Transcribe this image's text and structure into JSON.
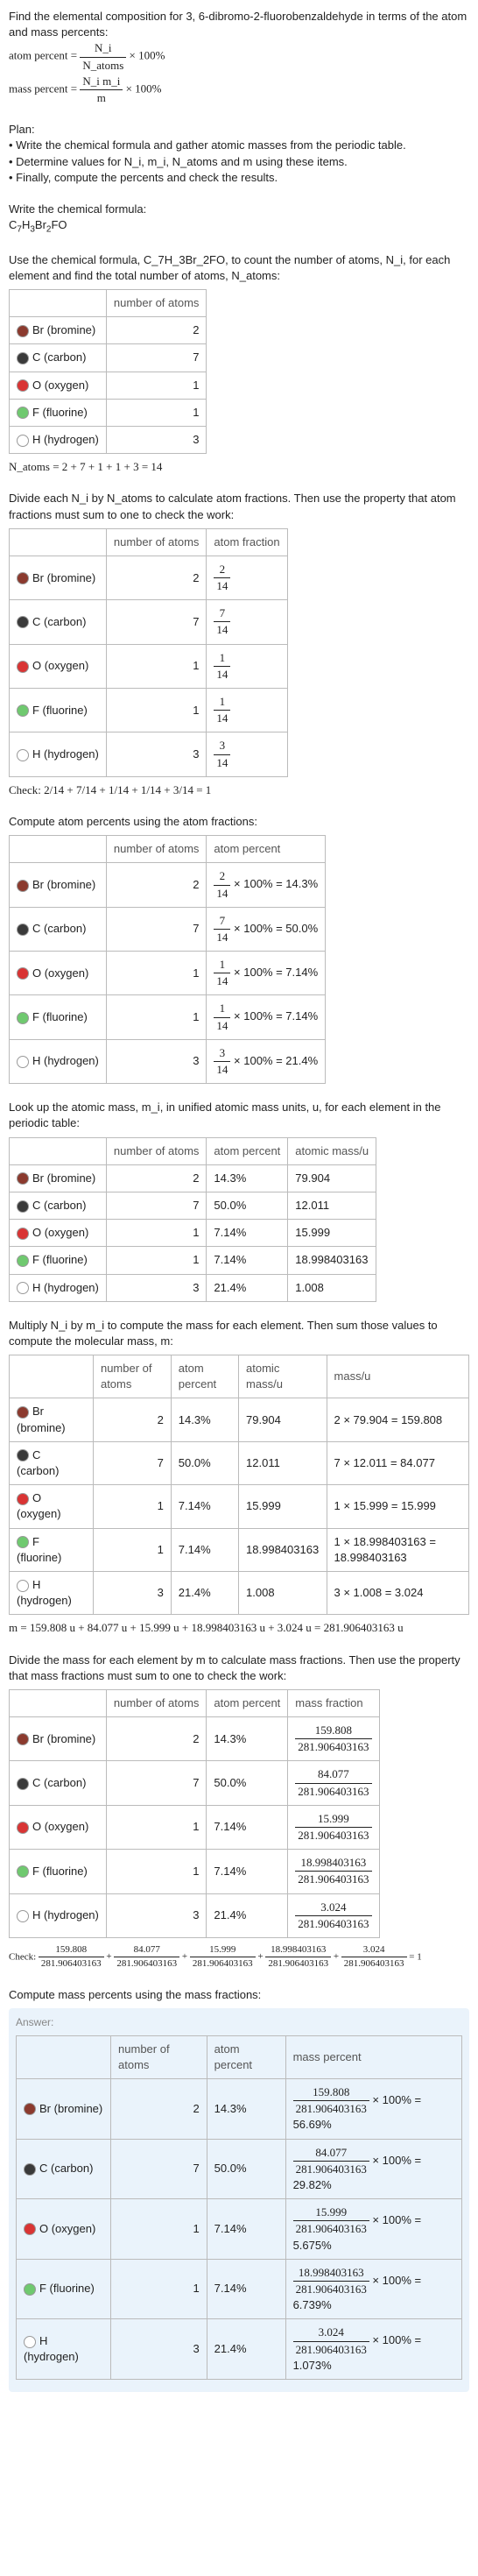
{
  "intro": {
    "line1": "Find the elemental composition for 3, 6-dibromo-2-fluorobenzaldehyde in terms of the atom and mass percents:",
    "atom_label": "atom percent =",
    "atom_num": "N_i",
    "atom_den": "N_atoms",
    "times100": "× 100%",
    "mass_label": "mass percent =",
    "mass_num": "N_i m_i",
    "mass_den": "m"
  },
  "plan": {
    "h": "Plan:",
    "b1": "• Write the chemical formula and gather atomic masses from the periodic table.",
    "b2": "• Determine values for N_i, m_i, N_atoms and m using these items.",
    "b3": "• Finally, compute the percents and check the results."
  },
  "step1": {
    "t": "Write the chemical formula:",
    "f": "C_7H_3Br_2FO"
  },
  "step2": {
    "t": "Use the chemical formula, C_7H_3Br_2FO, to count the number of atoms, N_i, for each element and find the total number of atoms, N_atoms:",
    "h1": "number of atoms",
    "r": [
      [
        "Br (bromine)",
        "2"
      ],
      [
        "C (carbon)",
        "7"
      ],
      [
        "O (oxygen)",
        "1"
      ],
      [
        "F (fluorine)",
        "1"
      ],
      [
        "H (hydrogen)",
        "3"
      ]
    ],
    "sum": "N_atoms = 2 + 7 + 1 + 1 + 3 = 14"
  },
  "step3": {
    "t": "Divide each N_i by N_atoms to calculate atom fractions. Then use the property that atom fractions must sum to one to check the work:",
    "h1": "number of atoms",
    "h2": "atom fraction",
    "r": [
      [
        "Br (bromine)",
        "2",
        "2",
        "14"
      ],
      [
        "C (carbon)",
        "7",
        "7",
        "14"
      ],
      [
        "O (oxygen)",
        "1",
        "1",
        "14"
      ],
      [
        "F (fluorine)",
        "1",
        "1",
        "14"
      ],
      [
        "H (hydrogen)",
        "3",
        "3",
        "14"
      ]
    ],
    "check": "Check: 2/14 + 7/14 + 1/14 + 1/14 + 3/14 = 1"
  },
  "step4": {
    "t": "Compute atom percents using the atom fractions:",
    "h1": "number of atoms",
    "h2": "atom percent",
    "r": [
      [
        "Br (bromine)",
        "2",
        "2",
        "14",
        "× 100% = 14.3%"
      ],
      [
        "C (carbon)",
        "7",
        "7",
        "14",
        "× 100% = 50.0%"
      ],
      [
        "O (oxygen)",
        "1",
        "1",
        "14",
        "× 100% = 7.14%"
      ],
      [
        "F (fluorine)",
        "1",
        "1",
        "14",
        "× 100% = 7.14%"
      ],
      [
        "H (hydrogen)",
        "3",
        "3",
        "14",
        "× 100% = 21.4%"
      ]
    ]
  },
  "step5": {
    "t": "Look up the atomic mass, m_i, in unified atomic mass units, u, for each element in the periodic table:",
    "h1": "number of atoms",
    "h2": "atom percent",
    "h3": "atomic mass/u",
    "r": [
      [
        "Br (bromine)",
        "2",
        "14.3%",
        "79.904"
      ],
      [
        "C (carbon)",
        "7",
        "50.0%",
        "12.011"
      ],
      [
        "O (oxygen)",
        "1",
        "7.14%",
        "15.999"
      ],
      [
        "F (fluorine)",
        "1",
        "7.14%",
        "18.998403163"
      ],
      [
        "H (hydrogen)",
        "3",
        "21.4%",
        "1.008"
      ]
    ]
  },
  "step6": {
    "t": "Multiply N_i by m_i to compute the mass for each element. Then sum those values to compute the molecular mass, m:",
    "h1": "number of atoms",
    "h2": "atom percent",
    "h3": "atomic mass/u",
    "h4": "mass/u",
    "r": [
      [
        "Br (bromine)",
        "2",
        "14.3%",
        "79.904",
        "2 × 79.904 = 159.808"
      ],
      [
        "C (carbon)",
        "7",
        "50.0%",
        "12.011",
        "7 × 12.011 = 84.077"
      ],
      [
        "O (oxygen)",
        "1",
        "7.14%",
        "15.999",
        "1 × 15.999 = 15.999"
      ],
      [
        "F (fluorine)",
        "1",
        "7.14%",
        "18.998403163",
        "1 × 18.998403163 = 18.998403163"
      ],
      [
        "H (hydrogen)",
        "3",
        "21.4%",
        "1.008",
        "3 × 1.008 = 3.024"
      ]
    ],
    "sum": "m = 159.808 u + 84.077 u + 15.999 u + 18.998403163 u + 3.024 u = 281.906403163 u"
  },
  "step7": {
    "t": "Divide the mass for each element by m to calculate mass fractions. Then use the property that mass fractions must sum to one to check the work:",
    "h1": "number of atoms",
    "h2": "atom percent",
    "h3": "mass fraction",
    "r": [
      [
        "Br (bromine)",
        "2",
        "14.3%",
        "159.808",
        "281.906403163"
      ],
      [
        "C (carbon)",
        "7",
        "50.0%",
        "84.077",
        "281.906403163"
      ],
      [
        "O (oxygen)",
        "1",
        "7.14%",
        "15.999",
        "281.906403163"
      ],
      [
        "F (fluorine)",
        "1",
        "7.14%",
        "18.998403163",
        "281.906403163"
      ],
      [
        "H (hydrogen)",
        "3",
        "21.4%",
        "3.024",
        "281.906403163"
      ]
    ],
    "check_l": "Check:",
    "check_r": "= 1"
  },
  "step8": {
    "t": "Compute mass percents using the mass fractions:",
    "ans": "Answer:",
    "h1": "number of atoms",
    "h2": "atom percent",
    "h3": "mass percent",
    "r": [
      [
        "Br (bromine)",
        "2",
        "14.3%",
        "159.808",
        "281.906403163",
        "× 100% = 56.69%"
      ],
      [
        "C (carbon)",
        "7",
        "50.0%",
        "84.077",
        "281.906403163",
        "× 100% = 29.82%"
      ],
      [
        "O (oxygen)",
        "1",
        "7.14%",
        "15.999",
        "281.906403163",
        "× 100% = 5.675%"
      ],
      [
        "F (fluorine)",
        "1",
        "7.14%",
        "18.998403163",
        "281.906403163",
        "× 100% = 6.739%"
      ],
      [
        "H (hydrogen)",
        "3",
        "21.4%",
        "3.024",
        "281.906403163",
        "× 100% = 1.073%"
      ]
    ]
  },
  "check7": [
    [
      "159.808",
      "281.906403163"
    ],
    [
      "84.077",
      "281.906403163"
    ],
    [
      "15.999",
      "281.906403163"
    ],
    [
      "18.998403163",
      "281.906403163"
    ],
    [
      "3.024",
      "281.906403163"
    ]
  ]
}
